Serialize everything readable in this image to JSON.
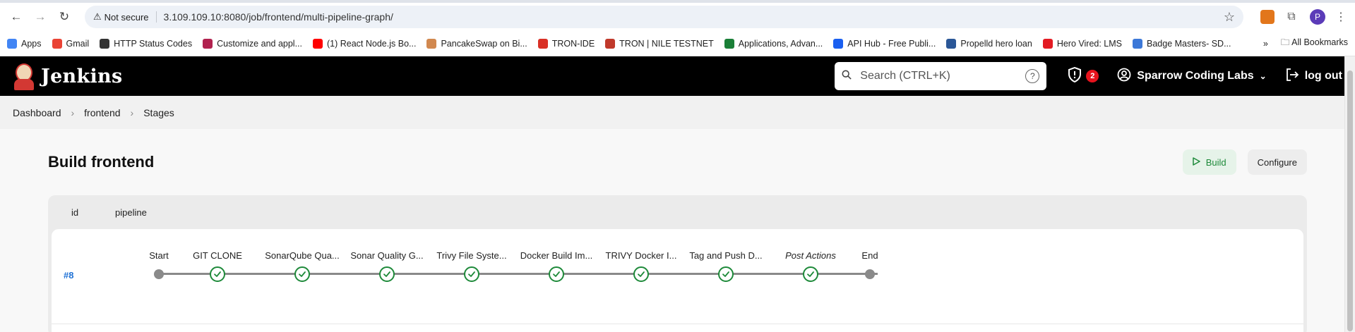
{
  "browser": {
    "security": "Not secure",
    "url": "3.109.109.10:8080/job/frontend/multi-pipeline-graph/",
    "profile_initial": "P",
    "bookmarks": [
      {
        "label": "Apps",
        "color": "#4285f4"
      },
      {
        "label": "Gmail",
        "color": "#ea4335"
      },
      {
        "label": "HTTP Status Codes",
        "color": "#333333"
      },
      {
        "label": "Customize and appl...",
        "color": "#b1224f"
      },
      {
        "label": "(1) React Node.js Bo...",
        "color": "#ff0000"
      },
      {
        "label": "PancakeSwap on Bi...",
        "color": "#d1884f"
      },
      {
        "label": "TRON-IDE",
        "color": "#d93025"
      },
      {
        "label": "TRON | NILE TESTNET",
        "color": "#c0392b"
      },
      {
        "label": "Applications, Advan...",
        "color": "#1a7f37"
      },
      {
        "label": "API Hub - Free Publi...",
        "color": "#1a5ff0"
      },
      {
        "label": "Propelld hero loan",
        "color": "#2b5797"
      },
      {
        "label": "Hero Vired: LMS",
        "color": "#e31b23"
      },
      {
        "label": "Badge Masters- SD...",
        "color": "#3c78d8"
      }
    ],
    "all_bookmarks": "All Bookmarks"
  },
  "header": {
    "brand": "Jenkins",
    "search_placeholder": "Search (CTRL+K)",
    "help": "?",
    "security_count": "2",
    "user": "Sparrow Coding Labs",
    "logout": "log out"
  },
  "breadcrumb": [
    "Dashboard",
    "frontend",
    "Stages"
  ],
  "page": {
    "title": "Build frontend",
    "build_label": "Build",
    "configure_label": "Configure"
  },
  "table": {
    "col_id": "id",
    "col_pipeline": "pipeline",
    "run": "#8",
    "stages": [
      {
        "label": "Start",
        "kind": "start"
      },
      {
        "label": "GIT CLONE",
        "kind": "success"
      },
      {
        "label": "SonarQube Qua...",
        "kind": "success"
      },
      {
        "label": "Sonar Quality G...",
        "kind": "success"
      },
      {
        "label": "Trivy File Syste...",
        "kind": "success"
      },
      {
        "label": "Docker Build Im...",
        "kind": "success"
      },
      {
        "label": "TRIVY Docker I...",
        "kind": "success"
      },
      {
        "label": "Tag and Push D...",
        "kind": "success"
      },
      {
        "label": "Post Actions",
        "kind": "success",
        "italic": true
      },
      {
        "label": "End",
        "kind": "end"
      }
    ]
  },
  "colors": {
    "success": "#1e8a3a",
    "link": "#2173d6",
    "header_bg": "#000000",
    "badge": "#e6131d"
  }
}
